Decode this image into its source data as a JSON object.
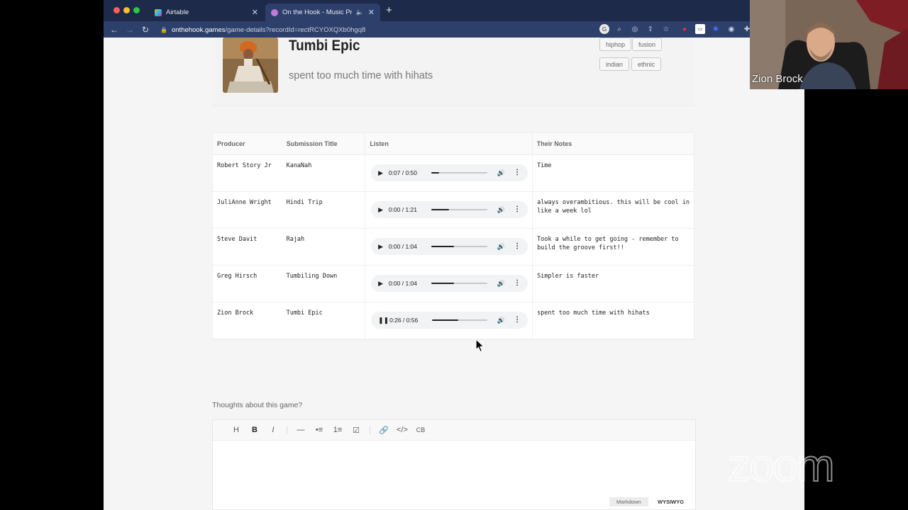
{
  "browser": {
    "tabs": [
      {
        "title": "Airtable",
        "active": false
      },
      {
        "title": "On the Hook - Music Produ",
        "active": true
      }
    ],
    "url_host": "onthehook.games",
    "url_path": "/game-details?recordId=rectRCYOXQXb0hgq8"
  },
  "game": {
    "title": "Tumbi Epic",
    "subtitle": "spent too much time with hihats",
    "tags": [
      "hiphop",
      "fusion",
      "indian",
      "ethnic"
    ]
  },
  "table": {
    "headers": [
      "Producer",
      "Submission Title",
      "Listen",
      "Their Notes"
    ],
    "rows": [
      {
        "producer": "Robert Story Jr",
        "title": "KanaNah",
        "time": "0:07 / 0:50",
        "progress": 0.14,
        "playing": false,
        "notes": "Time"
      },
      {
        "producer": "JuliAnne Wright",
        "title": "Hindi Trip",
        "time": "0:00 / 1:21",
        "progress": 0.32,
        "playing": false,
        "notes": "always overambitious. this will be cool in like a week lol"
      },
      {
        "producer": "Steve Davit",
        "title": "Rajah",
        "time": "0:00 / 1:04",
        "progress": 0.4,
        "playing": false,
        "notes": "Took a while to get going - remember to build the groove first!!"
      },
      {
        "producer": "Greg Hirsch",
        "title": "Tumbiling Down",
        "time": "0:00 / 1:04",
        "progress": 0.4,
        "playing": false,
        "notes": "Simpler is faster"
      },
      {
        "producer": "Zion Brock",
        "title": "Tumbi Epic",
        "time": "0:26 / 0:56",
        "progress": 0.47,
        "playing": true,
        "notes": "spent too much time with hihats"
      }
    ]
  },
  "feedback": {
    "label": "Thoughts about this game?",
    "toolbar": [
      "H",
      "B",
      "I",
      "—",
      "•≡",
      "1≡",
      "☑",
      "🔗",
      "</>",
      "CB"
    ],
    "mode_markdown": "Markdown",
    "mode_wysiwyg": "WYSIWYG"
  },
  "webcam": {
    "name": "Zion Brock"
  },
  "watermark": "zoom"
}
